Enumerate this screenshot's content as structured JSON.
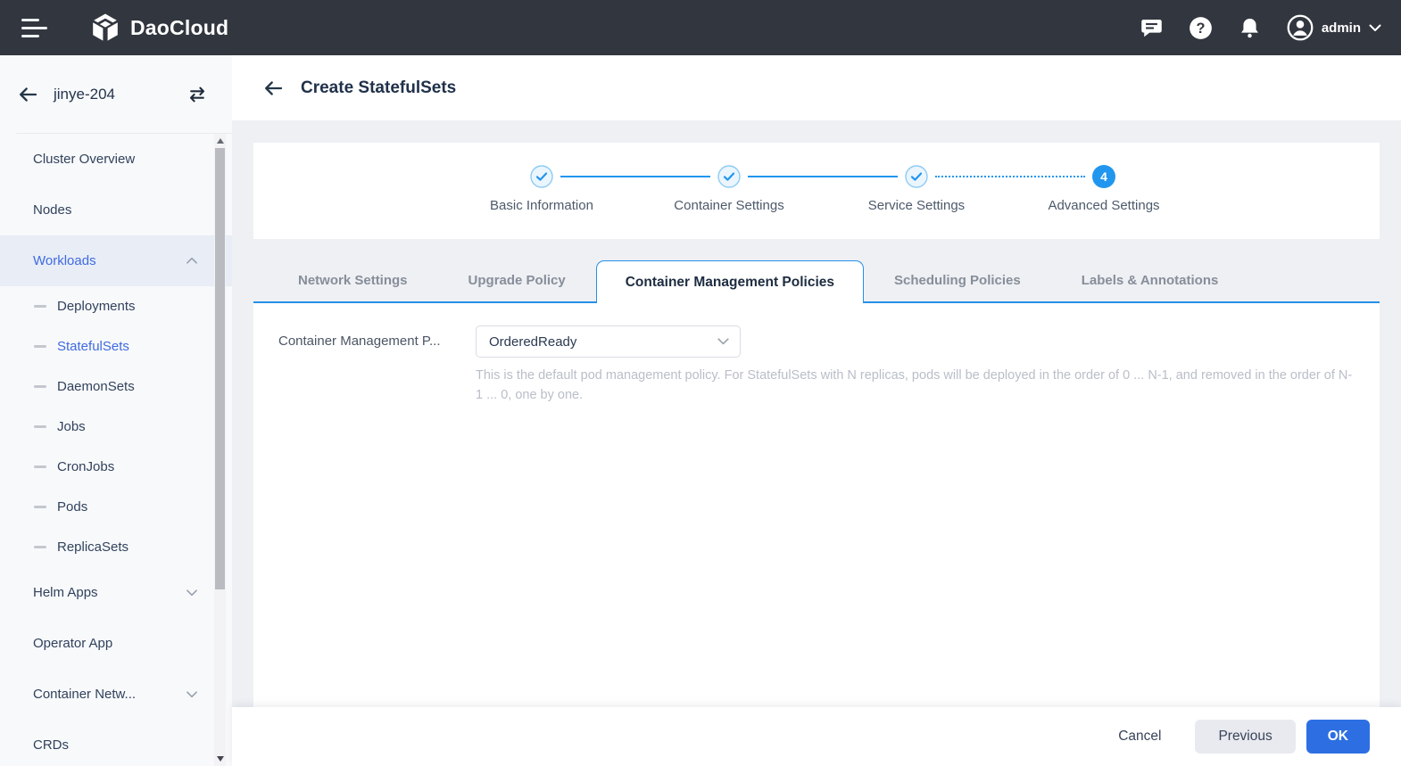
{
  "topbar": {
    "brand": "DaoCloud",
    "user": "admin",
    "icons": [
      "menu-icon",
      "daocloud-logo-icon",
      "messages-icon",
      "help-icon",
      "notifications-icon",
      "avatar-icon",
      "chevron-down-icon"
    ]
  },
  "sidebar": {
    "cluster": "jinye-204",
    "header_icons": [
      "back-arrow-icon",
      "switch-cluster-icon"
    ],
    "items": [
      {
        "label": "Cluster Overview",
        "sub": false,
        "chevron": null,
        "active": false,
        "parent_active": false
      },
      {
        "label": "Nodes",
        "sub": false,
        "chevron": null,
        "active": false,
        "parent_active": false
      },
      {
        "label": "Workloads",
        "sub": false,
        "chevron": "up",
        "active": true,
        "parent_active": true
      },
      {
        "label": "Deployments",
        "sub": true,
        "chevron": null,
        "active": false,
        "parent_active": false
      },
      {
        "label": "StatefulSets",
        "sub": true,
        "chevron": null,
        "active": true,
        "parent_active": false
      },
      {
        "label": "DaemonSets",
        "sub": true,
        "chevron": null,
        "active": false,
        "parent_active": false
      },
      {
        "label": "Jobs",
        "sub": true,
        "chevron": null,
        "active": false,
        "parent_active": false
      },
      {
        "label": "CronJobs",
        "sub": true,
        "chevron": null,
        "active": false,
        "parent_active": false
      },
      {
        "label": "Pods",
        "sub": true,
        "chevron": null,
        "active": false,
        "parent_active": false
      },
      {
        "label": "ReplicaSets",
        "sub": true,
        "chevron": null,
        "active": false,
        "parent_active": false
      },
      {
        "label": "Helm Apps",
        "sub": false,
        "chevron": "down",
        "active": false,
        "parent_active": false
      },
      {
        "label": "Operator App",
        "sub": false,
        "chevron": null,
        "active": false,
        "parent_active": false
      },
      {
        "label": "Container Netw...",
        "sub": false,
        "chevron": "down",
        "active": false,
        "parent_active": false
      },
      {
        "label": "CRDs",
        "sub": false,
        "chevron": null,
        "active": false,
        "parent_active": false
      }
    ]
  },
  "page": {
    "title": "Create StatefulSets",
    "steps": [
      {
        "label": "Basic Information",
        "state": "done"
      },
      {
        "label": "Container Settings",
        "state": "done"
      },
      {
        "label": "Service Settings",
        "state": "done"
      },
      {
        "label": "Advanced Settings",
        "state": "current",
        "number": "4"
      }
    ],
    "tabs": [
      {
        "label": "Network Settings",
        "active": false
      },
      {
        "label": "Upgrade Policy",
        "active": false
      },
      {
        "label": "Container Management Policies",
        "active": true
      },
      {
        "label": "Scheduling Policies",
        "active": false
      },
      {
        "label": "Labels & Annotations",
        "active": false
      }
    ],
    "form": {
      "label": "Container Management P...",
      "select_value": "OrderedReady",
      "help": "This is the default pod management policy. For StatefulSets with N replicas, pods will be deployed in the order of 0 ... N-1, and removed in the order of N-1 ... 0, one by one."
    },
    "footer": {
      "cancel": "Cancel",
      "previous": "Previous",
      "ok": "OK"
    }
  },
  "colors": {
    "topbar_bg": "#32363f",
    "accent_blue": "#2590e9",
    "step_blue": "#2196ef",
    "link_blue": "#3f6be0",
    "ok_button": "#2d6fe3",
    "page_bg": "#eef0f4",
    "sidebar_bg": "#f8f9fb",
    "sidebar_active_bg": "#e8edf6"
  }
}
